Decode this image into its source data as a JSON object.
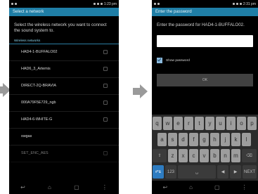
{
  "screen1": {
    "status_time": "1:23 pm",
    "title": "Select a network",
    "prompt": "Select the wireless network you want to connect the sound system to.",
    "section_label": "Wireless networks",
    "networks": [
      {
        "label": "HAD4-1-BUFFALO02"
      },
      {
        "label": "HAD6_3_Artemis"
      },
      {
        "label": "DIRECT-2Q-BRAVIA"
      },
      {
        "label": "000A79F5E729_ngb"
      },
      {
        "label": "HAD4-6-WHITE-G"
      },
      {
        "label": "swgas"
      },
      {
        "label": "SET_ENC_AES"
      }
    ]
  },
  "screen2": {
    "status_time": "2:31 pm",
    "title": "Enter the password",
    "prompt": "Enter the password for HAD4-1-BUFFALO02.",
    "password_value": "",
    "show_password_label": "Show password",
    "show_password_checked": true,
    "ok_label": "OK",
    "keyboard": {
      "row1": [
        "q",
        "w",
        "e",
        "r",
        "t",
        "y",
        "u",
        "i",
        "o",
        "p"
      ],
      "row2": [
        "a",
        "s",
        "d",
        "f",
        "g",
        "h",
        "j",
        "k",
        "l"
      ],
      "row3": [
        "z",
        "x",
        "c",
        "v",
        "b",
        "n",
        "m"
      ],
      "shift": "⇧",
      "backspace": "⌫",
      "mode_key": "#*&",
      "num_key": "123",
      "space": "␣",
      "left": "◀",
      "right": "▶",
      "next": "NEXT"
    }
  },
  "navbar": {
    "back": "↩",
    "home": "⌂",
    "recent": "▢",
    "menu": "⋮"
  },
  "colors": {
    "accent": "#1f7ea6",
    "key": "#9d9d9d",
    "background": "#000000"
  }
}
